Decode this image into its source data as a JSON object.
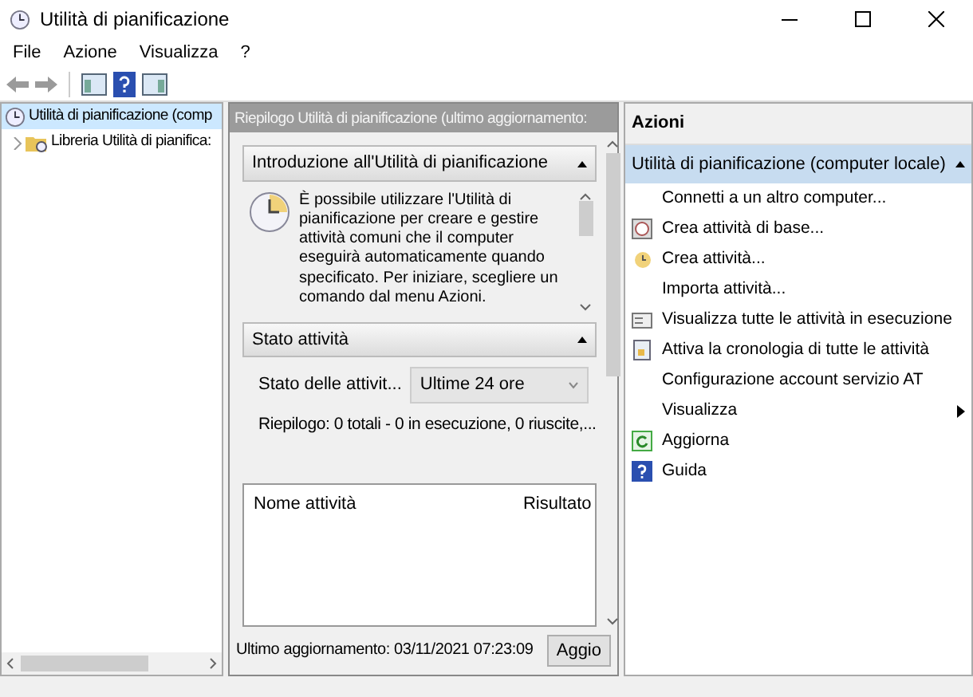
{
  "window": {
    "title": "Utilità di pianificazione"
  },
  "menu": [
    "File",
    "Azione",
    "Visualizza",
    "?"
  ],
  "tree": [
    {
      "label": "Utilità di pianificazione (comp",
      "selected": true,
      "children": [
        {
          "label": "Libreria Utilità di pianifica:",
          "selected": false,
          "expanded": false
        }
      ]
    }
  ],
  "summary": {
    "header": "Riepilogo Utilità di pianificazione (ultimo aggiornamento:",
    "intro": {
      "title": "Introduzione all'Utilità di pianificazione",
      "text": "È possibile utilizzare l'Utilità di pianificazione per creare e gestire attività comuni che il computer eseguirà automaticamente quando specificato. Per iniziare, scegliere un comando dal menu Azioni."
    },
    "status": {
      "title": "Stato attività",
      "filter_label": "Stato delle attivit...",
      "filter_value": "Ultime 24 ore",
      "summary": "Riepilogo: 0 totali - 0 in esecuzione, 0 riuscite,...",
      "columns": [
        "Nome attività",
        "Risultato"
      ]
    },
    "last_update": "Ultimo aggiornamento: 03/11/2021 07:23:09",
    "refresh_button": "Aggio"
  },
  "actions": {
    "title": "Azioni",
    "group": "Utilità di pianificazione (computer locale)",
    "items": [
      {
        "label": "Connetti a un altro computer...",
        "kind": "plain"
      },
      {
        "label": "Crea attività di base...",
        "kind": "wizard"
      },
      {
        "label": "Crea attività...",
        "kind": "task"
      },
      {
        "label": "Importa attività...",
        "kind": "plain"
      },
      {
        "label": "Visualizza tutte le attività in esecuzione",
        "kind": "list"
      },
      {
        "label": "Attiva la cronologia di tutte le attività",
        "kind": "history"
      },
      {
        "label": "Configurazione account servizio AT",
        "kind": "plain"
      },
      {
        "label": "Visualizza",
        "kind": "submenu"
      },
      {
        "label": "Aggiorna",
        "kind": "refresh"
      },
      {
        "label": "Guida",
        "kind": "help"
      }
    ]
  }
}
